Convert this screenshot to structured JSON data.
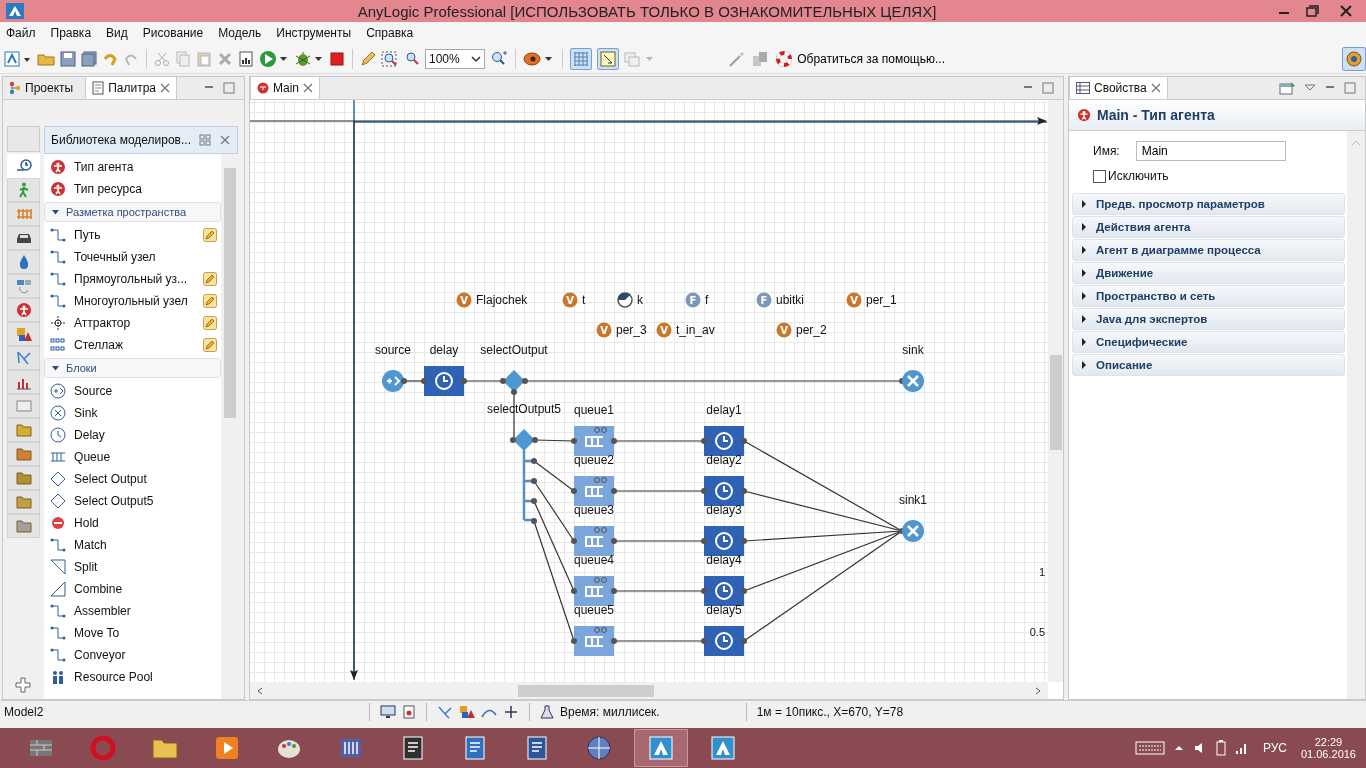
{
  "window": {
    "title": "AnyLogic Professional [ИСПОЛЬЗОВАТЬ ТОЛЬКО В ОЗНАКОМИТЕЛЬНЫХ ЦЕЛЯХ]"
  },
  "menu": [
    "Файл",
    "Правка",
    "Вид",
    "Рисование",
    "Модель",
    "Инструменты",
    "Справка"
  ],
  "toolbar": {
    "zoom": "100%",
    "help": "Обратиться за помощью..."
  },
  "left_tabs": [
    {
      "label": "Проекты",
      "selected": false
    },
    {
      "label": "Палитра",
      "selected": true
    }
  ],
  "palette": {
    "title": "Библиотека моделиров...",
    "categories": [
      {
        "selected": true
      },
      {
        "selected": false
      },
      {
        "selected": false
      },
      {
        "selected": false
      },
      {
        "selected": false
      },
      {
        "selected": false
      },
      {
        "selected": false
      },
      {
        "selected": false
      },
      {
        "selected": false
      },
      {
        "selected": false
      },
      {
        "selected": false
      },
      {
        "selected": false
      },
      {
        "selected": false
      },
      {
        "selected": false
      },
      {
        "selected": false
      },
      {
        "selected": false
      }
    ],
    "items": [
      {
        "kind": "item",
        "label": "Тип агента",
        "editable": false
      },
      {
        "kind": "item",
        "label": "Тип ресурса",
        "editable": false
      },
      {
        "kind": "section",
        "label": "Разметка пространства",
        "expanded": true
      },
      {
        "kind": "item",
        "label": "Путь",
        "editable": true
      },
      {
        "kind": "item",
        "label": "Точечный узел",
        "editable": false
      },
      {
        "kind": "item",
        "label": "Прямоугольный уз...",
        "editable": true
      },
      {
        "kind": "item",
        "label": "Многоугольный узел",
        "editable": true
      },
      {
        "kind": "item",
        "label": "Аттрактор",
        "editable": true
      },
      {
        "kind": "item",
        "label": "Стеллаж",
        "editable": true
      },
      {
        "kind": "section",
        "label": "Блоки",
        "expanded": true
      },
      {
        "kind": "item",
        "label": "Source",
        "editable": false
      },
      {
        "kind": "item",
        "label": "Sink",
        "editable": false
      },
      {
        "kind": "item",
        "label": "Delay",
        "editable": false
      },
      {
        "kind": "item",
        "label": "Queue",
        "editable": false
      },
      {
        "kind": "item",
        "label": "Select Output",
        "editable": false
      },
      {
        "kind": "item",
        "label": "Select Output5",
        "editable": false
      },
      {
        "kind": "item",
        "label": "Hold",
        "editable": false
      },
      {
        "kind": "item",
        "label": "Match",
        "editable": false
      },
      {
        "kind": "item",
        "label": "Split",
        "editable": false
      },
      {
        "kind": "item",
        "label": "Combine",
        "editable": false
      },
      {
        "kind": "item",
        "label": "Assembler",
        "editable": false
      },
      {
        "kind": "item",
        "label": "Move To",
        "editable": false
      },
      {
        "kind": "item",
        "label": "Conveyor",
        "editable": false
      },
      {
        "kind": "item",
        "label": "Resource Pool",
        "editable": false
      }
    ]
  },
  "editor": {
    "tabs": [
      {
        "label": "Main",
        "selected": true
      }
    ],
    "parameters": [
      {
        "kind": "variable",
        "badge": "V",
        "name": "Flajochek"
      },
      {
        "kind": "variable",
        "badge": "V",
        "name": "t"
      },
      {
        "kind": "gauge",
        "name": "k"
      },
      {
        "kind": "function",
        "badge": "F",
        "name": "f"
      },
      {
        "kind": "function",
        "badge": "F",
        "name": "ubitki"
      },
      {
        "kind": "variable",
        "badge": "V",
        "name": "per_1"
      },
      {
        "kind": "variable",
        "badge": "V",
        "name": "per_3"
      },
      {
        "kind": "variable",
        "badge": "V",
        "name": "t_in_av"
      },
      {
        "kind": "variable",
        "badge": "V",
        "name": "per_2"
      }
    ],
    "blocks": [
      {
        "kind": "source",
        "name": "source"
      },
      {
        "kind": "delay",
        "name": "delay"
      },
      {
        "kind": "select",
        "name": "selectOutput"
      },
      {
        "kind": "sink",
        "name": "sink"
      },
      {
        "kind": "select5",
        "name": "selectOutput5"
      },
      {
        "kind": "queue",
        "name": "queue1"
      },
      {
        "kind": "queue",
        "name": "queue2"
      },
      {
        "kind": "queue",
        "name": "queue3"
      },
      {
        "kind": "queue",
        "name": "queue4"
      },
      {
        "kind": "queue",
        "name": "queue5"
      },
      {
        "kind": "delay",
        "name": "delay1"
      },
      {
        "kind": "delay",
        "name": "delay2"
      },
      {
        "kind": "delay",
        "name": "delay3"
      },
      {
        "kind": "delay",
        "name": "delay4"
      },
      {
        "kind": "delay",
        "name": "delay5"
      },
      {
        "kind": "sink",
        "name": "sink1"
      }
    ],
    "ruler_labels": [
      "1",
      "0.5"
    ]
  },
  "properties": {
    "tab": "Свойства",
    "title": "Main - Тип агента",
    "name_label": "Имя:",
    "name_value": "Main",
    "exclude": {
      "label": "Исключить",
      "checked": false
    },
    "sections": [
      {
        "label": "Предв. просмотр параметров",
        "expanded": false
      },
      {
        "label": "Действия агента",
        "expanded": false
      },
      {
        "label": "Агент в диаграмме процесса",
        "expanded": false
      },
      {
        "label": "Движение",
        "expanded": false
      },
      {
        "label": "Пространство и сеть",
        "expanded": false
      },
      {
        "label": "Java для экспертов",
        "expanded": false
      },
      {
        "label": "Специфические",
        "expanded": false
      },
      {
        "label": "Описание",
        "expanded": false
      }
    ]
  },
  "status_bar": {
    "model": "Model2",
    "time_unit": "Время: миллисек.",
    "scale": "1м = 10пикс., X=670, Y=78"
  },
  "taskbar": {
    "apps": [
      {
        "selected": false
      },
      {
        "selected": false
      },
      {
        "selected": false
      },
      {
        "selected": false
      },
      {
        "selected": false
      },
      {
        "selected": false
      },
      {
        "selected": false
      },
      {
        "selected": false
      },
      {
        "selected": false
      },
      {
        "selected": false
      },
      {
        "selected": true
      },
      {
        "selected": false
      }
    ],
    "language": "РУС",
    "time": "22:29",
    "date": "01.06.2016"
  }
}
